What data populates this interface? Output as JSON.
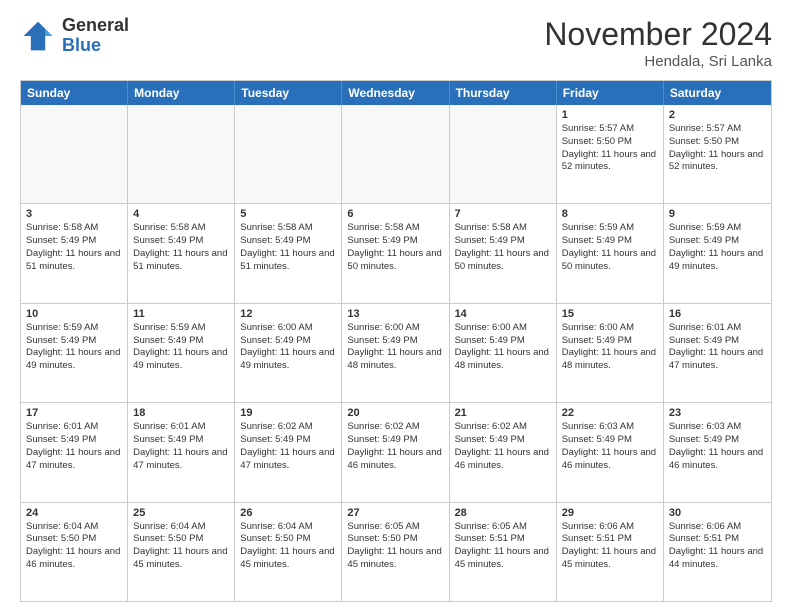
{
  "logo": {
    "general": "General",
    "blue": "Blue"
  },
  "header": {
    "month": "November 2024",
    "location": "Hendala, Sri Lanka"
  },
  "weekdays": [
    "Sunday",
    "Monday",
    "Tuesday",
    "Wednesday",
    "Thursday",
    "Friday",
    "Saturday"
  ],
  "rows": [
    [
      {
        "day": "",
        "empty": true
      },
      {
        "day": "",
        "empty": true
      },
      {
        "day": "",
        "empty": true
      },
      {
        "day": "",
        "empty": true
      },
      {
        "day": "",
        "empty": true
      },
      {
        "day": "1",
        "sunrise": "5:57 AM",
        "sunset": "5:50 PM",
        "daylight": "11 hours and 52 minutes."
      },
      {
        "day": "2",
        "sunrise": "5:57 AM",
        "sunset": "5:50 PM",
        "daylight": "11 hours and 52 minutes."
      }
    ],
    [
      {
        "day": "3",
        "sunrise": "5:58 AM",
        "sunset": "5:49 PM",
        "daylight": "11 hours and 51 minutes."
      },
      {
        "day": "4",
        "sunrise": "5:58 AM",
        "sunset": "5:49 PM",
        "daylight": "11 hours and 51 minutes."
      },
      {
        "day": "5",
        "sunrise": "5:58 AM",
        "sunset": "5:49 PM",
        "daylight": "11 hours and 51 minutes."
      },
      {
        "day": "6",
        "sunrise": "5:58 AM",
        "sunset": "5:49 PM",
        "daylight": "11 hours and 50 minutes."
      },
      {
        "day": "7",
        "sunrise": "5:58 AM",
        "sunset": "5:49 PM",
        "daylight": "11 hours and 50 minutes."
      },
      {
        "day": "8",
        "sunrise": "5:59 AM",
        "sunset": "5:49 PM",
        "daylight": "11 hours and 50 minutes."
      },
      {
        "day": "9",
        "sunrise": "5:59 AM",
        "sunset": "5:49 PM",
        "daylight": "11 hours and 49 minutes."
      }
    ],
    [
      {
        "day": "10",
        "sunrise": "5:59 AM",
        "sunset": "5:49 PM",
        "daylight": "11 hours and 49 minutes."
      },
      {
        "day": "11",
        "sunrise": "5:59 AM",
        "sunset": "5:49 PM",
        "daylight": "11 hours and 49 minutes."
      },
      {
        "day": "12",
        "sunrise": "6:00 AM",
        "sunset": "5:49 PM",
        "daylight": "11 hours and 49 minutes."
      },
      {
        "day": "13",
        "sunrise": "6:00 AM",
        "sunset": "5:49 PM",
        "daylight": "11 hours and 48 minutes."
      },
      {
        "day": "14",
        "sunrise": "6:00 AM",
        "sunset": "5:49 PM",
        "daylight": "11 hours and 48 minutes."
      },
      {
        "day": "15",
        "sunrise": "6:00 AM",
        "sunset": "5:49 PM",
        "daylight": "11 hours and 48 minutes."
      },
      {
        "day": "16",
        "sunrise": "6:01 AM",
        "sunset": "5:49 PM",
        "daylight": "11 hours and 47 minutes."
      }
    ],
    [
      {
        "day": "17",
        "sunrise": "6:01 AM",
        "sunset": "5:49 PM",
        "daylight": "11 hours and 47 minutes."
      },
      {
        "day": "18",
        "sunrise": "6:01 AM",
        "sunset": "5:49 PM",
        "daylight": "11 hours and 47 minutes."
      },
      {
        "day": "19",
        "sunrise": "6:02 AM",
        "sunset": "5:49 PM",
        "daylight": "11 hours and 47 minutes."
      },
      {
        "day": "20",
        "sunrise": "6:02 AM",
        "sunset": "5:49 PM",
        "daylight": "11 hours and 46 minutes."
      },
      {
        "day": "21",
        "sunrise": "6:02 AM",
        "sunset": "5:49 PM",
        "daylight": "11 hours and 46 minutes."
      },
      {
        "day": "22",
        "sunrise": "6:03 AM",
        "sunset": "5:49 PM",
        "daylight": "11 hours and 46 minutes."
      },
      {
        "day": "23",
        "sunrise": "6:03 AM",
        "sunset": "5:49 PM",
        "daylight": "11 hours and 46 minutes."
      }
    ],
    [
      {
        "day": "24",
        "sunrise": "6:04 AM",
        "sunset": "5:50 PM",
        "daylight": "11 hours and 46 minutes."
      },
      {
        "day": "25",
        "sunrise": "6:04 AM",
        "sunset": "5:50 PM",
        "daylight": "11 hours and 45 minutes."
      },
      {
        "day": "26",
        "sunrise": "6:04 AM",
        "sunset": "5:50 PM",
        "daylight": "11 hours and 45 minutes."
      },
      {
        "day": "27",
        "sunrise": "6:05 AM",
        "sunset": "5:50 PM",
        "daylight": "11 hours and 45 minutes."
      },
      {
        "day": "28",
        "sunrise": "6:05 AM",
        "sunset": "5:51 PM",
        "daylight": "11 hours and 45 minutes."
      },
      {
        "day": "29",
        "sunrise": "6:06 AM",
        "sunset": "5:51 PM",
        "daylight": "11 hours and 45 minutes."
      },
      {
        "day": "30",
        "sunrise": "6:06 AM",
        "sunset": "5:51 PM",
        "daylight": "11 hours and 44 minutes."
      }
    ]
  ]
}
